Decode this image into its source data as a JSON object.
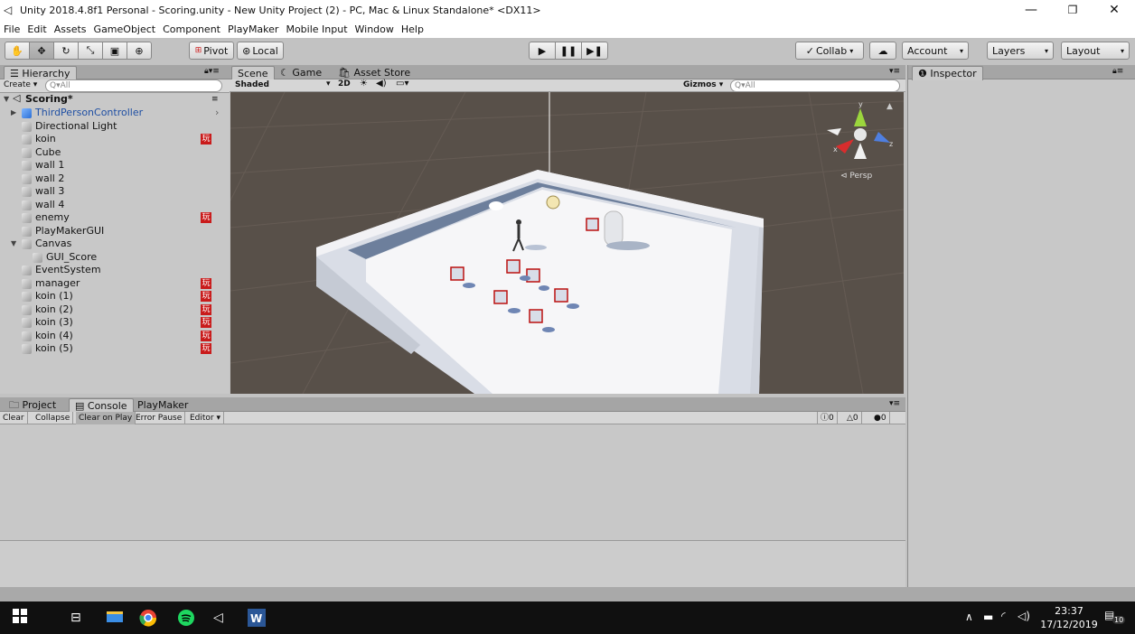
{
  "window": {
    "title": "Unity 2018.4.8f1 Personal - Scoring.unity - New Unity Project (2) - PC, Mac & Linux Standalone* <DX11>"
  },
  "menu": [
    "File",
    "Edit",
    "Assets",
    "GameObject",
    "Component",
    "PlayMaker",
    "Mobile Input",
    "Window",
    "Help"
  ],
  "toolbar": {
    "pivot": "Pivot",
    "local": "Local",
    "collab": "Collab",
    "account": "Account",
    "layers": "Layers",
    "layout": "Layout"
  },
  "hierarchy": {
    "tab": "Hierarchy",
    "create": "Create",
    "search_placeholder": "Q▾All",
    "scene_name": "Scoring*",
    "items": [
      {
        "label": "ThirdPersonController",
        "pm": false,
        "blue": true
      },
      {
        "label": "Directional Light",
        "pm": false
      },
      {
        "label": "koin",
        "pm": true
      },
      {
        "label": "Cube",
        "pm": false
      },
      {
        "label": "wall 1",
        "pm": false
      },
      {
        "label": "wall 2",
        "pm": false
      },
      {
        "label": "wall 3",
        "pm": false
      },
      {
        "label": "wall 4",
        "pm": false
      },
      {
        "label": "enemy",
        "pm": true
      },
      {
        "label": "PlayMakerGUI",
        "pm": false
      },
      {
        "label": "Canvas",
        "pm": false
      },
      {
        "label": "GUI_Score",
        "pm": false
      },
      {
        "label": "EventSystem",
        "pm": false
      },
      {
        "label": "manager",
        "pm": true
      },
      {
        "label": "koin (1)",
        "pm": true
      },
      {
        "label": "koin (2)",
        "pm": true
      },
      {
        "label": "koin (3)",
        "pm": true
      },
      {
        "label": "koin (4)",
        "pm": true
      },
      {
        "label": "koin (5)",
        "pm": true
      }
    ],
    "pm_glyph": "玩"
  },
  "scene": {
    "tabs": [
      "Scene",
      "Game",
      "Asset Store"
    ],
    "shading": "Shaded",
    "mode_2d": "2D",
    "gizmos": "Gizmos",
    "search_placeholder": "Q▾All",
    "persp": "Persp",
    "axis_x": "x",
    "axis_y": "y",
    "axis_z": "z"
  },
  "inspector": {
    "tab": "Inspector"
  },
  "console": {
    "tabs": [
      "Project",
      "Console",
      "PlayMaker"
    ],
    "buttons": [
      "Clear",
      "Collapse",
      "Clear on Play",
      "Error Pause",
      "Editor"
    ],
    "counts": [
      "0",
      "0",
      "0"
    ]
  },
  "taskbar": {
    "time": "23:37",
    "date": "17/12/2019",
    "notifications": "10"
  }
}
